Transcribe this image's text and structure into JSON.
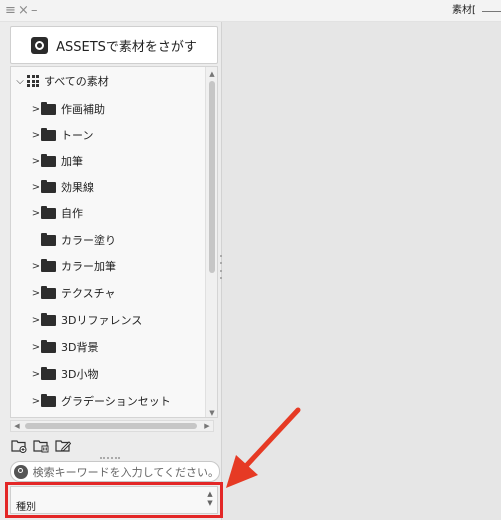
{
  "titlebar": {
    "menu_icon": "≡",
    "close_icon": "×",
    "minimize_icon": "–",
    "title": "素材["
  },
  "assets_button": {
    "label": "ASSETSで素材をさがす",
    "icon": "assets-logo-icon"
  },
  "tree": {
    "root_label": "すべての素材",
    "items": [
      {
        "label": "作画補助",
        "has_children": true
      },
      {
        "label": "トーン",
        "has_children": true
      },
      {
        "label": "加筆",
        "has_children": true
      },
      {
        "label": "効果線",
        "has_children": true
      },
      {
        "label": "自作",
        "has_children": true
      },
      {
        "label": "カラー塗り",
        "has_children": false
      },
      {
        "label": "カラー加筆",
        "has_children": true
      },
      {
        "label": "テクスチャ",
        "has_children": true
      },
      {
        "label": "3Dリファレンス",
        "has_children": true
      },
      {
        "label": "3D背景",
        "has_children": true
      },
      {
        "label": "3D小物",
        "has_children": true
      },
      {
        "label": "グラデーションセット",
        "has_children": true
      }
    ]
  },
  "toolbar": {
    "icons": [
      "new-folder-icon",
      "delete-folder-icon",
      "edit-folder-icon"
    ]
  },
  "search": {
    "placeholder": "検索キーワードを入力してください。"
  },
  "kind_select": {
    "label": "種別"
  },
  "colors": {
    "highlight": "#e32727",
    "arrow": "#e63a24"
  }
}
